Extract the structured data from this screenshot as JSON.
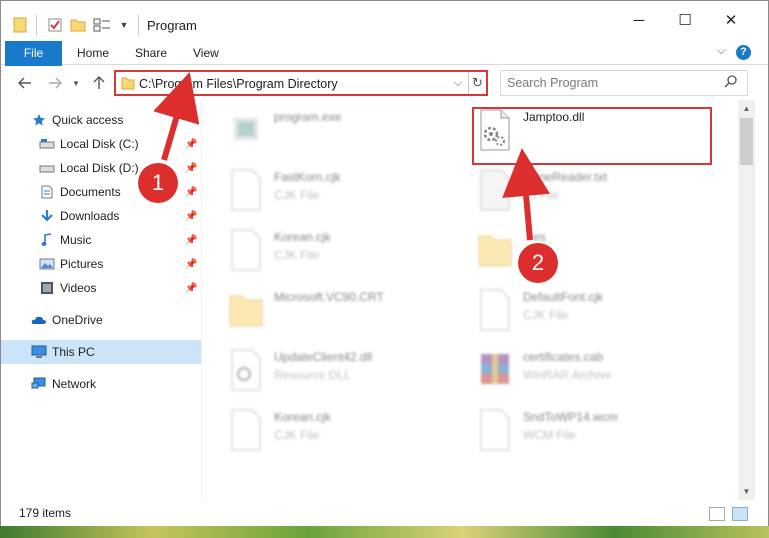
{
  "window": {
    "title": "Program",
    "controls": {
      "minimize": "─",
      "maximize": "☐",
      "close": "✕"
    }
  },
  "ribbon": {
    "tabs": [
      {
        "label": "File"
      },
      {
        "label": "Home"
      },
      {
        "label": "Share"
      },
      {
        "label": "View"
      }
    ],
    "expand_icon": "⌵",
    "help": "?"
  },
  "navigation": {
    "address_path": "C:\\Program Files\\Program Directory",
    "search_placeholder": "Search Program"
  },
  "sidebar": {
    "items": [
      {
        "label": "Quick access",
        "icon": "star-icon",
        "pinned": false
      },
      {
        "label": "Local Disk (C:)",
        "icon": "drive-icon",
        "pinned": true
      },
      {
        "label": "Local Disk (D:)",
        "icon": "drive-icon",
        "pinned": true
      },
      {
        "label": "Documents",
        "icon": "documents-icon",
        "pinned": true
      },
      {
        "label": "Downloads",
        "icon": "downloads-icon",
        "pinned": true
      },
      {
        "label": "Music",
        "icon": "music-icon",
        "pinned": true
      },
      {
        "label": "Pictures",
        "icon": "pictures-icon",
        "pinned": true
      },
      {
        "label": "Videos",
        "icon": "videos-icon",
        "pinned": true
      },
      {
        "label": "OneDrive",
        "icon": "onedrive-icon",
        "pinned": false
      },
      {
        "label": "This PC",
        "icon": "this-pc-icon",
        "pinned": false,
        "selected": true
      },
      {
        "label": "Network",
        "icon": "network-icon",
        "pinned": false
      }
    ]
  },
  "files": [
    {
      "name": "program.exe",
      "type": "",
      "icon": "exe-icon"
    },
    {
      "name": "Jamptoo.dll",
      "type": "",
      "icon": "dll-icon",
      "highlighted": true
    },
    {
      "name": "FastKorn.cjk",
      "type": "CJK File",
      "icon": "file-icon"
    },
    {
      "name": "...fineReader.txt",
      "type": "...t File",
      "icon": "file-icon"
    },
    {
      "name": "Korean.cjk",
      "type": "CJK File",
      "icon": "file-icon"
    },
    {
      "name": "...es",
      "type": "",
      "icon": "folder-icon"
    },
    {
      "name": "Microsoft.VC90.CRT",
      "type": "",
      "icon": "folder-icon"
    },
    {
      "name": "DefaultFont.cjk",
      "type": "CJK File",
      "icon": "file-icon"
    },
    {
      "name": "UpdateClient42.dll",
      "type": "Resource DLL",
      "icon": "dll-icon"
    },
    {
      "name": "certificates.cab",
      "type": "WinRAR Archive",
      "icon": "archive-icon"
    },
    {
      "name": "Korean.cjk",
      "type": "CJK File",
      "icon": "file-icon"
    },
    {
      "name": "SndToWP14.wcm",
      "type": "WCM File",
      "icon": "file-icon"
    }
  ],
  "status": {
    "item_count": "179 items"
  },
  "annotations": {
    "step1": "1",
    "step2": "2",
    "color": "#dd2e2e"
  }
}
